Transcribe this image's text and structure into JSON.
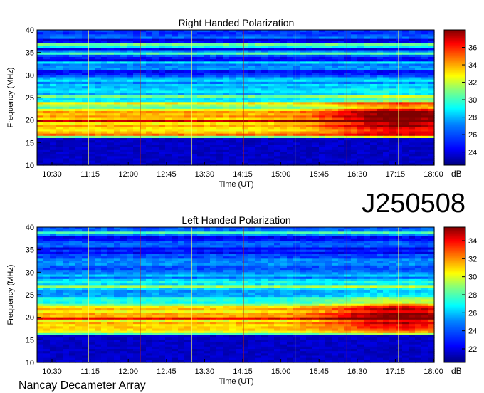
{
  "page_title": "J250508",
  "footer": "Nancay Decameter Array",
  "chart_data": [
    {
      "type": "heatmap",
      "title": "Right Handed Polarization",
      "xlabel": "Time (UT)",
      "ylabel": "Frequency (MHz)",
      "x_ticks": [
        "10:30",
        "11:15",
        "12:00",
        "12:45",
        "13:30",
        "14:15",
        "15:00",
        "15:45",
        "16:30",
        "17:15",
        "18:00"
      ],
      "y_ticks": [
        10,
        15,
        20,
        25,
        30,
        35,
        40
      ],
      "ylim": [
        10,
        40
      ],
      "colorbar": {
        "label": "dB",
        "ticks": [
          24,
          26,
          28,
          30,
          32,
          34,
          36
        ],
        "range": [
          22.5,
          38
        ]
      },
      "colormap": [
        "#00007f",
        "#0000ff",
        "#0080ff",
        "#00ffff",
        "#80ff80",
        "#ffff00",
        "#ff8000",
        "#ff0000",
        "#7f0000"
      ]
    },
    {
      "type": "heatmap",
      "title": "Left Handed Polarization",
      "xlabel": "Time (UT)",
      "ylabel": "Frequency (MHz)",
      "x_ticks": [
        "10:30",
        "11:15",
        "12:00",
        "12:45",
        "13:30",
        "14:15",
        "15:00",
        "15:45",
        "16:30",
        "17:15",
        "18:00"
      ],
      "y_ticks": [
        10,
        15,
        20,
        25,
        30,
        35,
        40
      ],
      "ylim": [
        10,
        40
      ],
      "colorbar": {
        "label": "dB",
        "ticks": [
          22,
          24,
          26,
          28,
          30,
          32,
          34
        ],
        "range": [
          20.5,
          35.5
        ]
      },
      "colormap": [
        "#00007f",
        "#0000ff",
        "#0080ff",
        "#00ffff",
        "#80ff80",
        "#ffff00",
        "#ff8000",
        "#ff0000",
        "#7f0000"
      ]
    }
  ]
}
